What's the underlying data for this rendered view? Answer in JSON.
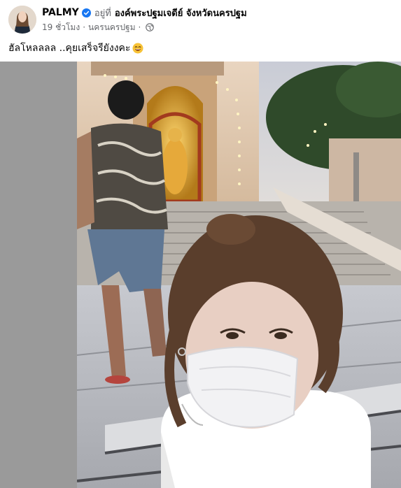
{
  "post": {
    "author": "PALMY",
    "checkin_prefix": "อยู่ที่",
    "place": "องค์พระปฐมเจดีย์ จังหวัดนครปฐม",
    "time": "19 ชั่วโมง",
    "location": "นครนครปฐม",
    "separator": "·",
    "caption": "ฮัลโหลลลล ..คุยเสร็จรียังงคะ",
    "emoji": "smiling-face-emoji",
    "icons": {
      "verified": "verified-badge-icon",
      "privacy": "globe-icon"
    }
  },
  "colors": {
    "verified": "#1877f2",
    "secondary_text": "#65676b",
    "photo_backdrop": "#9a9a9a"
  }
}
